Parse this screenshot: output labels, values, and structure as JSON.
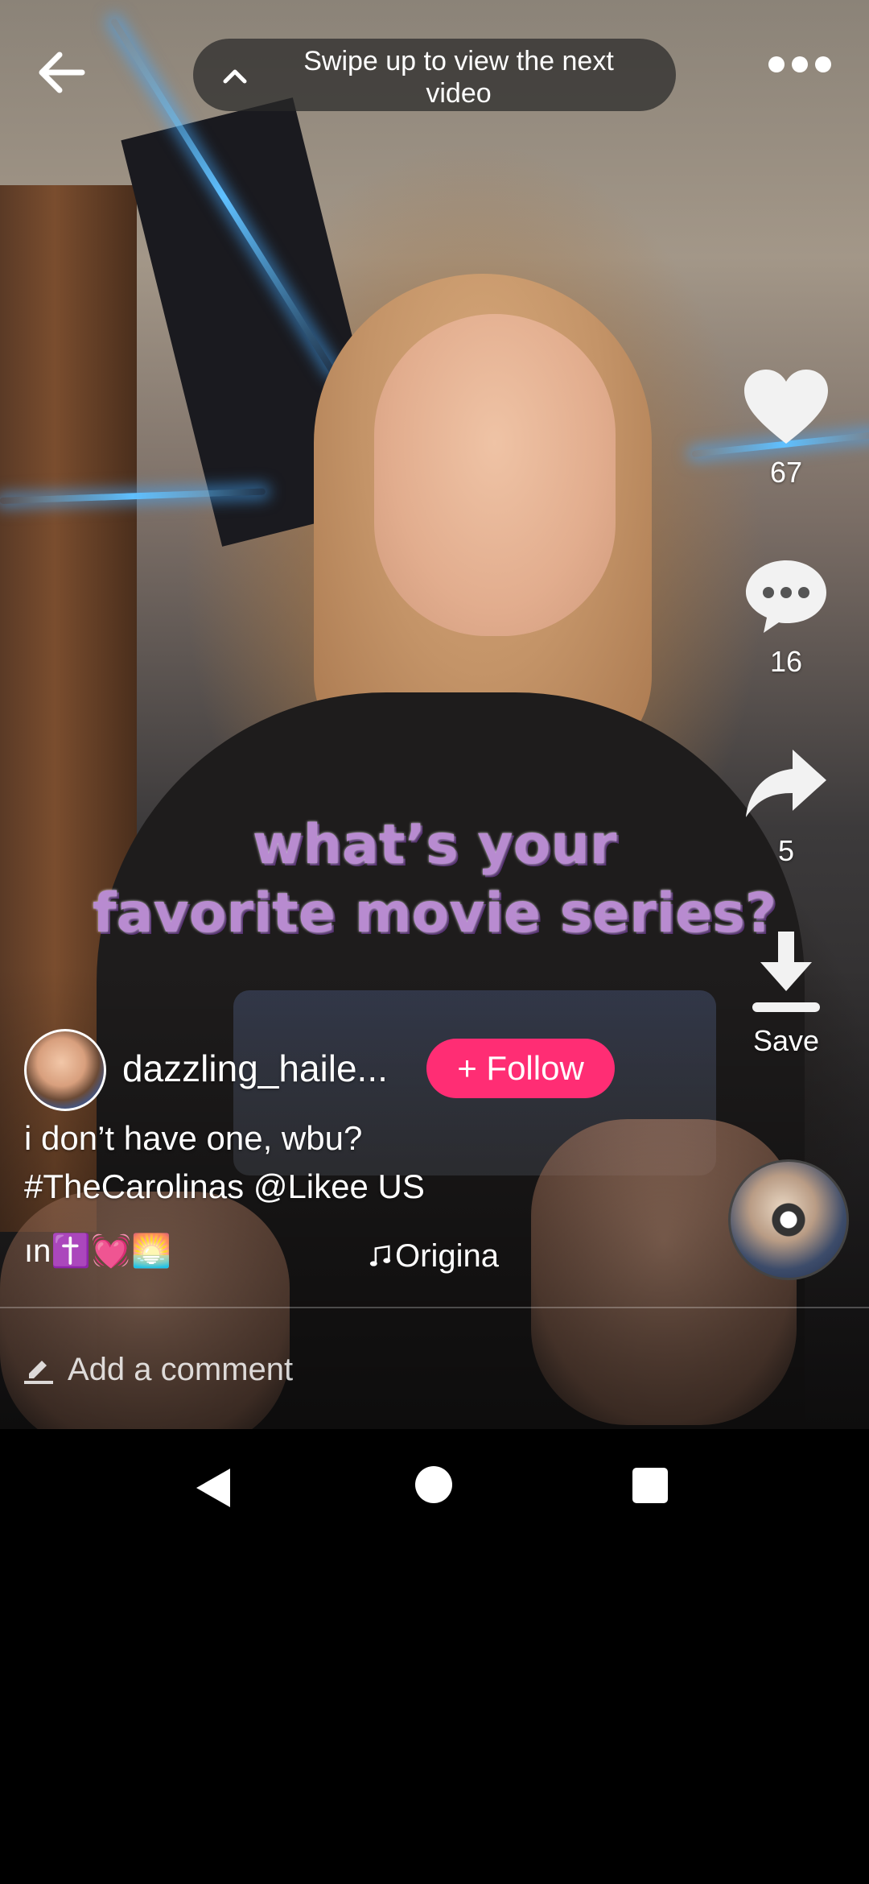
{
  "top_bar": {
    "back_icon": "arrow-left-icon",
    "hint": "Swipe up to view the next video",
    "hint_icon": "chevron-up-icon",
    "more_icon": "more-dots-icon"
  },
  "video": {
    "overlay_text_line1": "what’s your",
    "overlay_text_line2": "favorite movie series?"
  },
  "actions": {
    "like": {
      "icon": "heart-icon",
      "count": "67"
    },
    "comment": {
      "icon": "comment-bubble-icon",
      "count": "16"
    },
    "share": {
      "icon": "share-arrow-icon",
      "count": "5"
    },
    "save": {
      "icon": "download-icon",
      "label": "Save"
    }
  },
  "author": {
    "avatar_icon": "author-avatar",
    "username": "dazzling_haile...",
    "follow_label": "+ Follow"
  },
  "post": {
    "caption_line1": "i don’t have one, wbu?",
    "caption_line2": "#TheCarolinas @Likee US",
    "tags_marquee": "ın✝️💓🌅",
    "music_icon": "music-note-icon",
    "music_label": "Origina"
  },
  "comment_bar": {
    "icon": "pencil-icon",
    "placeholder": "Add a comment"
  },
  "nav": {
    "back_icon": "nav-back-icon",
    "home_icon": "nav-home-icon",
    "recents_icon": "nav-recents-icon"
  },
  "colors": {
    "follow_button": "#ff2d74",
    "overlay_text": "#b88bd0"
  }
}
